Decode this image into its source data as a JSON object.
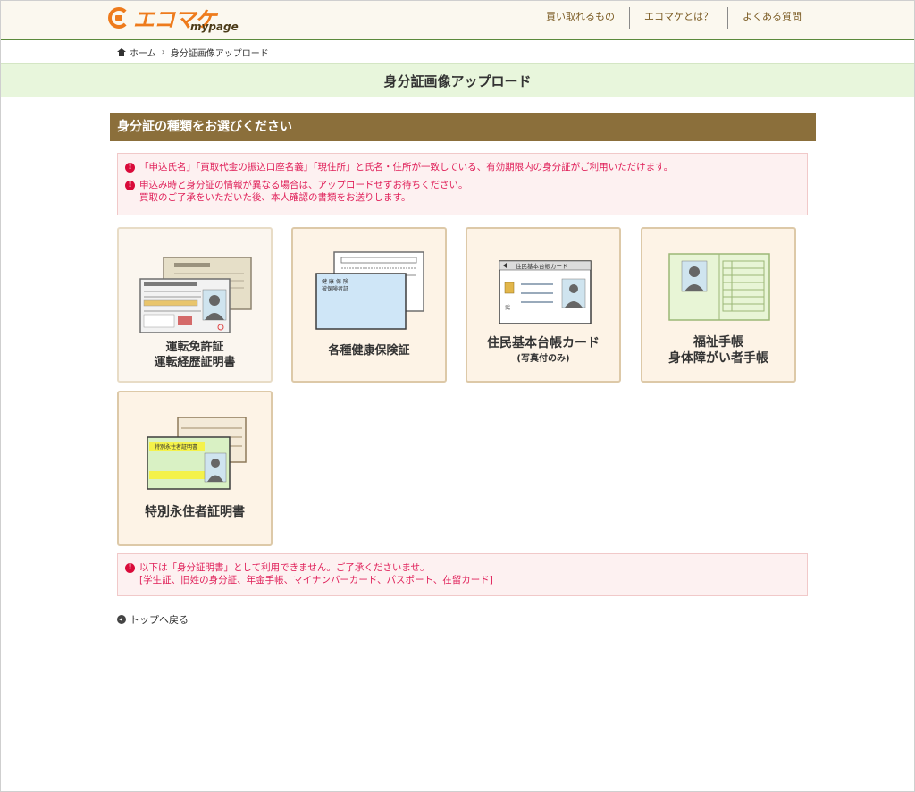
{
  "header": {
    "logo_main": "エコマケ",
    "logo_sub": "mypage",
    "nav": [
      "買い取れるもの",
      "エコマケとは？",
      "よくある質問"
    ]
  },
  "breadcrumb": {
    "home": "ホーム",
    "current": "身分証画像アップロード"
  },
  "page_title": "身分証画像アップロード",
  "section_title": "身分証の種類をお選びください",
  "notice_top": {
    "line1": "「申込氏名」「買取代金の振込口座名義」「現住所」と氏名・住所が一致している、有効期限内の身分証がご利用いただけます。",
    "line2a": "申込み時と身分証の情報が異なる場合は、アップロードせずお待ちください。",
    "line2b": "買取のご了承をいただいた後、本人確認の書類をお送りします。"
  },
  "cards": [
    {
      "line1": "運転免許証",
      "line2": "運転経歴証明書"
    },
    {
      "line1": "各種健康保険証"
    },
    {
      "line1": "住民基本台帳カード",
      "line2": "(写真付のみ)"
    },
    {
      "line1": "福祉手帳",
      "line2": "身体障がい者手帳"
    },
    {
      "line1": "特別永住者証明書"
    }
  ],
  "card_texts": {
    "insurance_label1": "健 康 保 険",
    "insurance_label2": "被保険者証",
    "juki_label": "住民基本台帳カード",
    "juki_char": "弐",
    "eijusha_label": "特別永住者証明書"
  },
  "notice_bottom": {
    "line1": "以下は「身分証明書」として利用できません。ご了承くださいませ。",
    "line2": "[学生証、旧姓の身分証、年金手帳、マイナンバーカード、パスポート、在留カード]"
  },
  "back_link": "トップへ戻る",
  "colors": {
    "brand_orange": "#ee7b1c",
    "section_brown": "#8b6f3b",
    "band_green": "#e8f6dc",
    "alert_red": "#e0215a"
  }
}
